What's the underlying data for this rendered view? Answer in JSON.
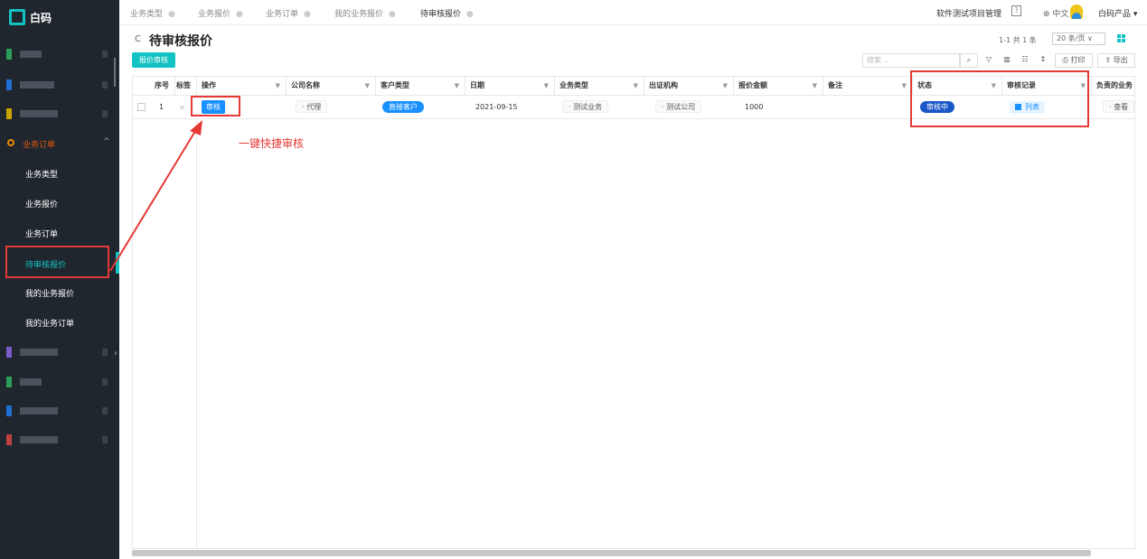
{
  "sidebar": {
    "logo": "白码",
    "group": "业务订单",
    "items": [
      "业务类型",
      "业务报价",
      "业务订单",
      "待审核报价",
      "我的业务报价",
      "我的业务订单"
    ],
    "blurred_colors": [
      "#2e9e5b",
      "#1f6fd1",
      "#c8a400",
      "#2e9e5b",
      "#2e9e5b",
      "#1f6fd1",
      "#c04040",
      "#7a5cc8"
    ]
  },
  "tabs": [
    {
      "label": "业务类型",
      "active": false
    },
    {
      "label": "业务报价",
      "active": false
    },
    {
      "label": "业务订单",
      "active": false
    },
    {
      "label": "我的业务报价",
      "active": false
    },
    {
      "label": "待审核报价",
      "active": true
    }
  ],
  "header": {
    "project": "软件测试项目管理",
    "help": "?",
    "lang": "中文",
    "product": "白码产品 ▾"
  },
  "page": {
    "title": "待审核报价",
    "action_button": "报价审核",
    "pager": "1-1 共 1 条",
    "page_size": "20 条/页",
    "search_placeholder": "搜索...",
    "print": "打印",
    "export": "导出"
  },
  "table": {
    "headers": [
      "序号",
      "标签",
      "操作",
      "公司名称",
      "客户类型",
      "日期",
      "业务类型",
      "出证机构",
      "报价金额",
      "备注",
      "状态",
      "审核记录",
      "负责的业务"
    ],
    "row": {
      "index": "1",
      "action": "审核",
      "company": "代理",
      "customer_type": "直接客户",
      "date": "2021-09-15",
      "business_type": "测试业务",
      "cert_org": "测试公司",
      "amount": "1000",
      "remark": "",
      "status": "审核中",
      "record": "列表",
      "owner_action": "查看"
    }
  },
  "annotation": {
    "text": "一键快捷审核",
    "color": "#e53935"
  }
}
